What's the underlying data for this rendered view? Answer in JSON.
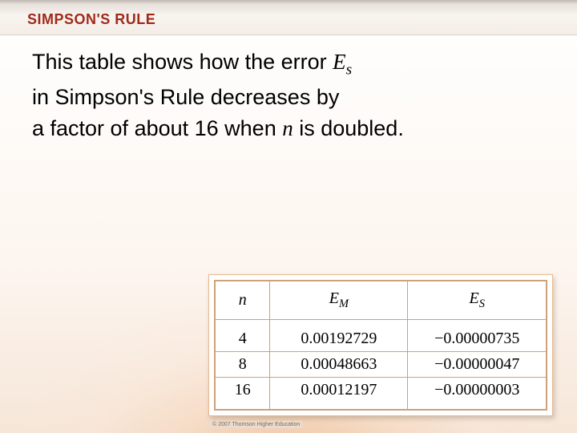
{
  "header": {
    "title": "SIMPSON'S RULE"
  },
  "body": {
    "line1a": "This table shows how the error ",
    "line1b_var": "E",
    "line1b_sub": "s",
    "line2": "in Simpson's Rule decreases by",
    "line3a": "a factor of about 16 when ",
    "line3b_var": "n",
    "line3c": " is doubled."
  },
  "table": {
    "headers": {
      "n": "n",
      "em_main": "E",
      "em_sub": "M",
      "es_main": "E",
      "es_sub": "S"
    },
    "rows": [
      {
        "n": "4",
        "em": "0.00192729",
        "es": "−0.00000735"
      },
      {
        "n": "8",
        "em": "0.00048663",
        "es": "−0.00000047"
      },
      {
        "n": "16",
        "em": "0.00012197",
        "es": "−0.00000003"
      }
    ]
  },
  "copyright": "© 2007 Thomson Higher Education"
}
